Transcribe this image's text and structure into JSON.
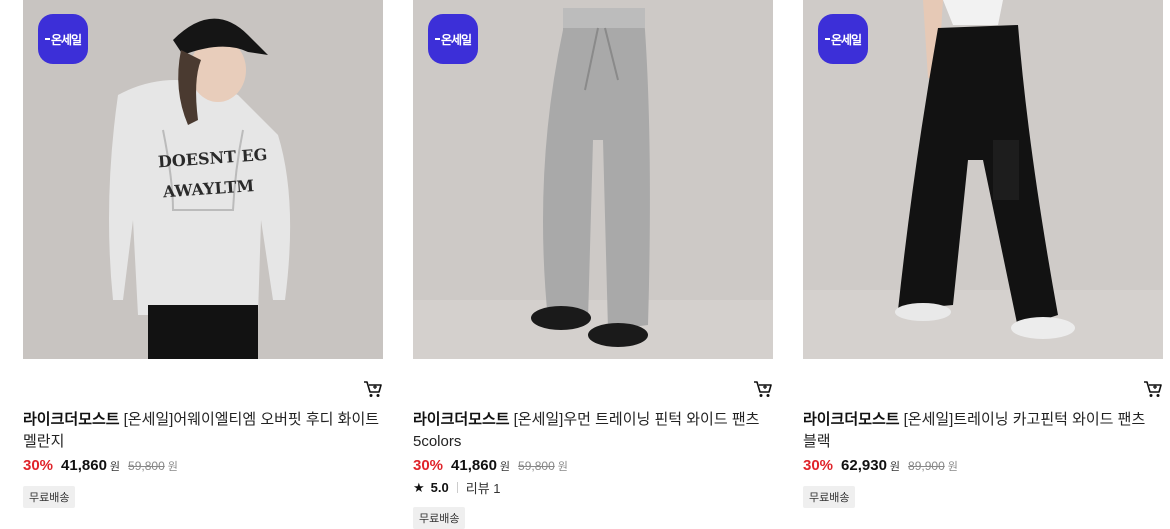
{
  "products": [
    {
      "badge": "온세일",
      "cart_icon": "cart-icon",
      "brand": "라이크더모스트",
      "name": "[온세일]어웨이엘티엠 오버핏 후디 화이트멜란지",
      "discount": "30%",
      "price": "41,860",
      "currency": "원",
      "original_price": "59,800",
      "original_currency": "원",
      "shipping": "무료배송"
    },
    {
      "badge": "온세일",
      "cart_icon": "cart-icon",
      "brand": "라이크더모스트",
      "name": "[온세일]우먼 트레이닝 핀턱 와이드 팬츠 5colors",
      "discount": "30%",
      "price": "41,860",
      "currency": "원",
      "original_price": "59,800",
      "original_currency": "원",
      "rating": "5.0",
      "review_label": "리뷰 1",
      "shipping": "무료배송"
    },
    {
      "badge": "온세일",
      "cart_icon": "cart-icon",
      "brand": "라이크더모스트",
      "name": "[온세일]트레이닝 카고핀턱 와이드 팬츠 블랙",
      "discount": "30%",
      "price": "62,930",
      "currency": "원",
      "original_price": "89,900",
      "original_currency": "원",
      "shipping": "무료배송"
    }
  ]
}
